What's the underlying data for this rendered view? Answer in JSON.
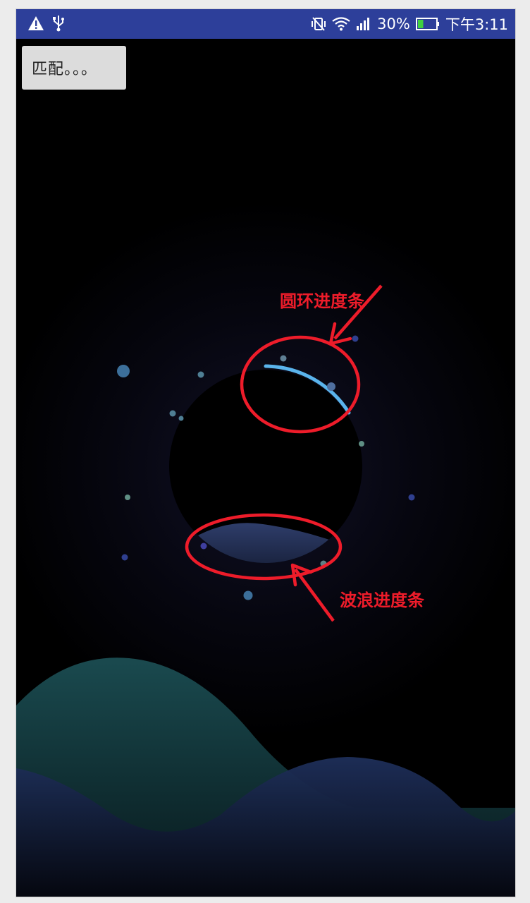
{
  "status_bar": {
    "time": "下午3:11",
    "battery_percent": "30%",
    "battery_level": 0.3,
    "left_icons": [
      "warning-icon",
      "usb-icon"
    ],
    "right_icons": [
      "vibrate-icon",
      "wifi-icon",
      "signal-icon",
      "battery-icon"
    ],
    "background_color": "#2d3f9a"
  },
  "match_button": {
    "label": "匹配。。。"
  },
  "annotations": {
    "ring_progress_label": "圆环进度条",
    "wave_progress_label": "波浪进度条",
    "color": "#ee1c2a"
  },
  "scene": {
    "ring_progress_color": "#5ab4ec",
    "wave_colors": [
      "#1a4a4f",
      "#1c2c55"
    ]
  }
}
